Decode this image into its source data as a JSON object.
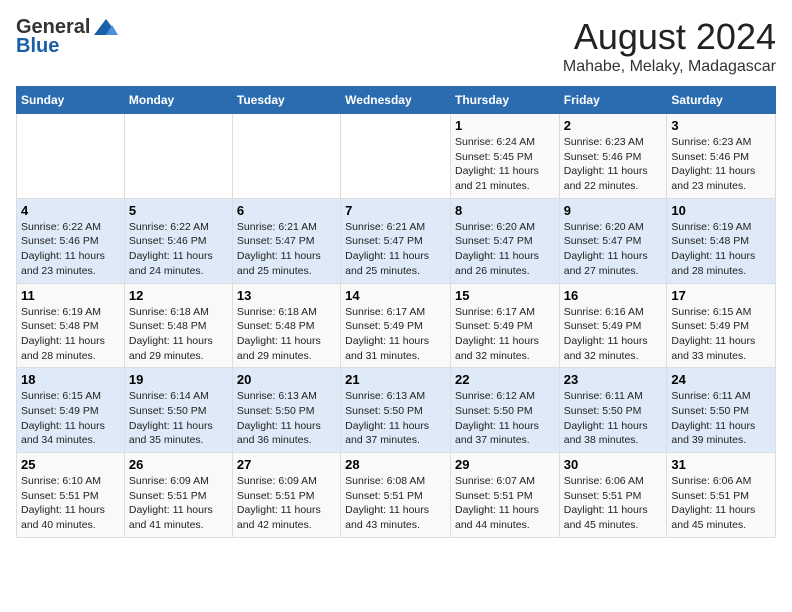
{
  "logo": {
    "general": "General",
    "blue": "Blue"
  },
  "title": "August 2024",
  "subtitle": "Mahabe, Melaky, Madagascar",
  "days_of_week": [
    "Sunday",
    "Monday",
    "Tuesday",
    "Wednesday",
    "Thursday",
    "Friday",
    "Saturday"
  ],
  "weeks": [
    [
      {
        "day": "",
        "content": ""
      },
      {
        "day": "",
        "content": ""
      },
      {
        "day": "",
        "content": ""
      },
      {
        "day": "",
        "content": ""
      },
      {
        "day": "1",
        "content": "Sunrise: 6:24 AM\nSunset: 5:45 PM\nDaylight: 11 hours\nand 21 minutes."
      },
      {
        "day": "2",
        "content": "Sunrise: 6:23 AM\nSunset: 5:46 PM\nDaylight: 11 hours\nand 22 minutes."
      },
      {
        "day": "3",
        "content": "Sunrise: 6:23 AM\nSunset: 5:46 PM\nDaylight: 11 hours\nand 23 minutes."
      }
    ],
    [
      {
        "day": "4",
        "content": "Sunrise: 6:22 AM\nSunset: 5:46 PM\nDaylight: 11 hours\nand 23 minutes."
      },
      {
        "day": "5",
        "content": "Sunrise: 6:22 AM\nSunset: 5:46 PM\nDaylight: 11 hours\nand 24 minutes."
      },
      {
        "day": "6",
        "content": "Sunrise: 6:21 AM\nSunset: 5:47 PM\nDaylight: 11 hours\nand 25 minutes."
      },
      {
        "day": "7",
        "content": "Sunrise: 6:21 AM\nSunset: 5:47 PM\nDaylight: 11 hours\nand 25 minutes."
      },
      {
        "day": "8",
        "content": "Sunrise: 6:20 AM\nSunset: 5:47 PM\nDaylight: 11 hours\nand 26 minutes."
      },
      {
        "day": "9",
        "content": "Sunrise: 6:20 AM\nSunset: 5:47 PM\nDaylight: 11 hours\nand 27 minutes."
      },
      {
        "day": "10",
        "content": "Sunrise: 6:19 AM\nSunset: 5:48 PM\nDaylight: 11 hours\nand 28 minutes."
      }
    ],
    [
      {
        "day": "11",
        "content": "Sunrise: 6:19 AM\nSunset: 5:48 PM\nDaylight: 11 hours\nand 28 minutes."
      },
      {
        "day": "12",
        "content": "Sunrise: 6:18 AM\nSunset: 5:48 PM\nDaylight: 11 hours\nand 29 minutes."
      },
      {
        "day": "13",
        "content": "Sunrise: 6:18 AM\nSunset: 5:48 PM\nDaylight: 11 hours\nand 29 minutes."
      },
      {
        "day": "14",
        "content": "Sunrise: 6:17 AM\nSunset: 5:49 PM\nDaylight: 11 hours\nand 31 minutes."
      },
      {
        "day": "15",
        "content": "Sunrise: 6:17 AM\nSunset: 5:49 PM\nDaylight: 11 hours\nand 32 minutes."
      },
      {
        "day": "16",
        "content": "Sunrise: 6:16 AM\nSunset: 5:49 PM\nDaylight: 11 hours\nand 32 minutes."
      },
      {
        "day": "17",
        "content": "Sunrise: 6:15 AM\nSunset: 5:49 PM\nDaylight: 11 hours\nand 33 minutes."
      }
    ],
    [
      {
        "day": "18",
        "content": "Sunrise: 6:15 AM\nSunset: 5:49 PM\nDaylight: 11 hours\nand 34 minutes."
      },
      {
        "day": "19",
        "content": "Sunrise: 6:14 AM\nSunset: 5:50 PM\nDaylight: 11 hours\nand 35 minutes."
      },
      {
        "day": "20",
        "content": "Sunrise: 6:13 AM\nSunset: 5:50 PM\nDaylight: 11 hours\nand 36 minutes."
      },
      {
        "day": "21",
        "content": "Sunrise: 6:13 AM\nSunset: 5:50 PM\nDaylight: 11 hours\nand 37 minutes."
      },
      {
        "day": "22",
        "content": "Sunrise: 6:12 AM\nSunset: 5:50 PM\nDaylight: 11 hours\nand 37 minutes."
      },
      {
        "day": "23",
        "content": "Sunrise: 6:11 AM\nSunset: 5:50 PM\nDaylight: 11 hours\nand 38 minutes."
      },
      {
        "day": "24",
        "content": "Sunrise: 6:11 AM\nSunset: 5:50 PM\nDaylight: 11 hours\nand 39 minutes."
      }
    ],
    [
      {
        "day": "25",
        "content": "Sunrise: 6:10 AM\nSunset: 5:51 PM\nDaylight: 11 hours\nand 40 minutes."
      },
      {
        "day": "26",
        "content": "Sunrise: 6:09 AM\nSunset: 5:51 PM\nDaylight: 11 hours\nand 41 minutes."
      },
      {
        "day": "27",
        "content": "Sunrise: 6:09 AM\nSunset: 5:51 PM\nDaylight: 11 hours\nand 42 minutes."
      },
      {
        "day": "28",
        "content": "Sunrise: 6:08 AM\nSunset: 5:51 PM\nDaylight: 11 hours\nand 43 minutes."
      },
      {
        "day": "29",
        "content": "Sunrise: 6:07 AM\nSunset: 5:51 PM\nDaylight: 11 hours\nand 44 minutes."
      },
      {
        "day": "30",
        "content": "Sunrise: 6:06 AM\nSunset: 5:51 PM\nDaylight: 11 hours\nand 45 minutes."
      },
      {
        "day": "31",
        "content": "Sunrise: 6:06 AM\nSunset: 5:51 PM\nDaylight: 11 hours\nand 45 minutes."
      }
    ]
  ]
}
